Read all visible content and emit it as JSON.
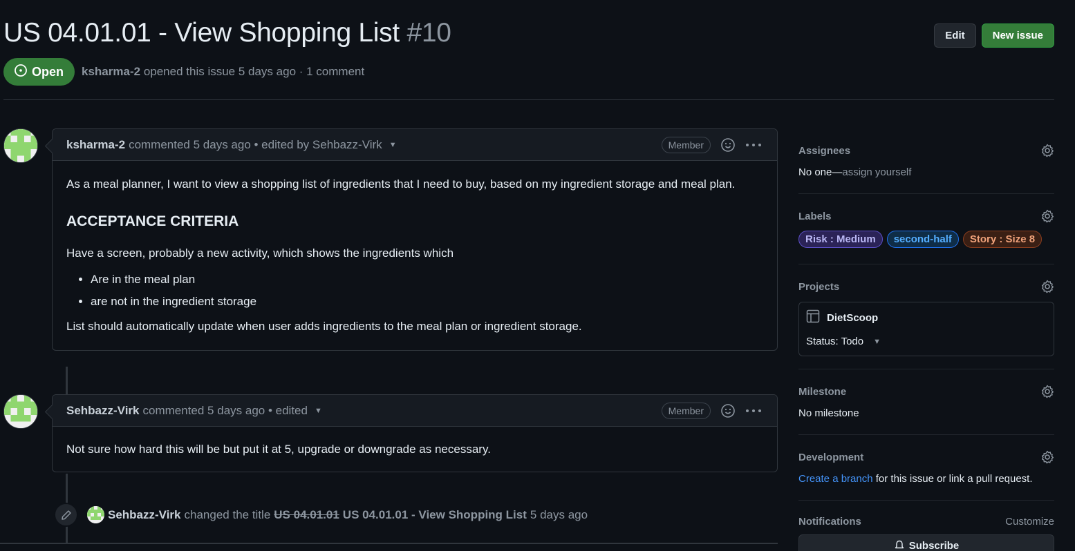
{
  "issue": {
    "title": "US 04.01.01 - View Shopping List",
    "number": "#10",
    "state": "Open",
    "author": "ksharma-2",
    "opened_text": "opened this issue 5 days ago · 1 comment"
  },
  "header_buttons": {
    "edit": "Edit",
    "new_issue": "New issue"
  },
  "comments": [
    {
      "author": "ksharma-2",
      "meta": "commented 5 days ago • edited by Sehbazz-Virk",
      "role": "Member",
      "body": {
        "intro": "As a meal planner, I want to view a shopping list of ingredients that I need to buy, based on my ingredient storage and meal plan.",
        "heading": "ACCEPTANCE CRITERIA",
        "para": "Have a screen, probably a new activity, which shows the ingredients which",
        "bullets": [
          "Are in the meal plan",
          "are not in the ingredient storage"
        ],
        "outro": "List should automatically update when user adds ingredients to the meal plan or ingredient storage."
      }
    },
    {
      "author": "Sehbazz-Virk",
      "meta": "commented 5 days ago • edited",
      "role": "Member",
      "body": {
        "text": "Not sure how hard this will be but put it at 5, upgrade or downgrade as necessary."
      }
    }
  ],
  "event": {
    "author": "Sehbazz-Virk",
    "action": "changed the title",
    "old_title": "US 04.01.01",
    "new_title": "US 04.01.01 - View Shopping List",
    "time": "5 days ago"
  },
  "sidebar": {
    "assignees": {
      "title": "Assignees",
      "value": "No one—",
      "action": "assign yourself"
    },
    "labels": {
      "title": "Labels",
      "items": [
        {
          "name": "Risk : Medium",
          "color": "#b9b6f3",
          "bg": "#2b2357",
          "border": "#5b4fc6"
        },
        {
          "name": "second-half",
          "color": "#54aeff",
          "bg": "#0f2d47",
          "border": "#1f6feb"
        },
        {
          "name": "Story : Size 8",
          "color": "#f0a27a",
          "bg": "#3a1f14",
          "border": "#8a3e1f"
        }
      ]
    },
    "projects": {
      "title": "Projects",
      "name": "DietScoop",
      "status": "Status: Todo"
    },
    "milestone": {
      "title": "Milestone",
      "value": "No milestone"
    },
    "development": {
      "title": "Development",
      "link": "Create a branch",
      "rest": " for this issue or link a pull request."
    },
    "notifications": {
      "title": "Notifications",
      "customize": "Customize",
      "subscribe": "Subscribe"
    }
  }
}
